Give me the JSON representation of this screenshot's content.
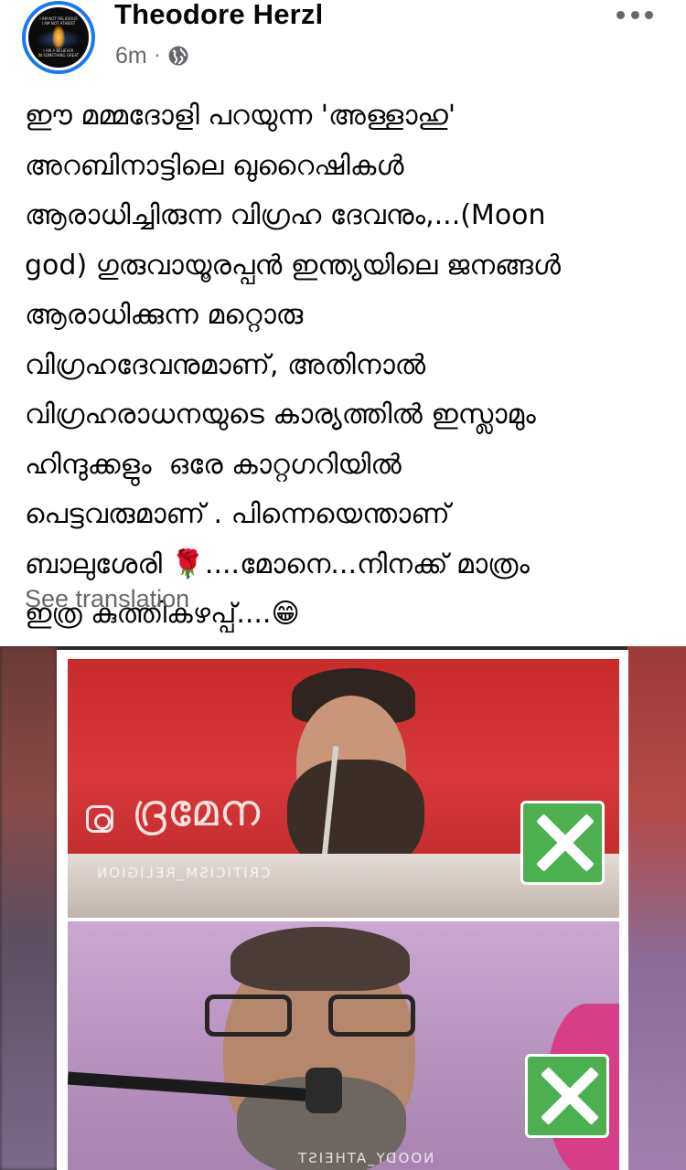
{
  "post": {
    "author": "Theodore Herzl",
    "time": "6m",
    "separator": "·",
    "privacy_icon": "globe-icon",
    "more_icon": "more-options-icon",
    "text": "ഈ മമ്മദോളി പറയുന്ന 'അള്ളാഹു'\nഅറബിനാട്ടിലെ ഖുറൈഷികൾ\nആരാധിച്ചിരുന്ന വിഗ്രഹ ദേവനും,...(Moon\ngod) ഗുരുവായൂരപ്പൻ ഇന്ത്യയിലെ ജനങ്ങൾ\nആരാധിക്കുന്ന മറ്റൊരു\nവിഗ്രഹദേവനുമാണ്, അതിനാൽ\nവിഗ്രഹരാധനയുടെ കാര്യത്തിൽ ഇസ്ലാമും\nഹിന്ദുക്കളും  ഒരേ കാറ്റഗറിയിൽ\nപെട്ടവരുമാണ് . പിന്നെയെന്താണ്\nബാലുശേരി 🌹....മോനെ...നിനക്ക് മാത്രം\nഇത്ര കുത്തികഴപ്പ്....😁",
    "see_translation": "See translation"
  },
  "avatar": {
    "top_text": "I AM NOT RELIGIOUS\nI AM NOT ATHEIST",
    "bottom_text": "I AM A BELIEVER\nIN SOMETHING GREAT"
  },
  "media": {
    "top_banner_text": "ദ്രമേന",
    "top_watermark": "CRITICISM_RELIGION",
    "bottom_watermark": "NOODY_ATHEIST",
    "colors": {
      "green_x": "#4caf50",
      "top_bg": "#c92a2a",
      "bottom_bg": "#b893c0"
    }
  },
  "colors": {
    "accent": "#1877f2",
    "secondary_text": "#65676b"
  }
}
